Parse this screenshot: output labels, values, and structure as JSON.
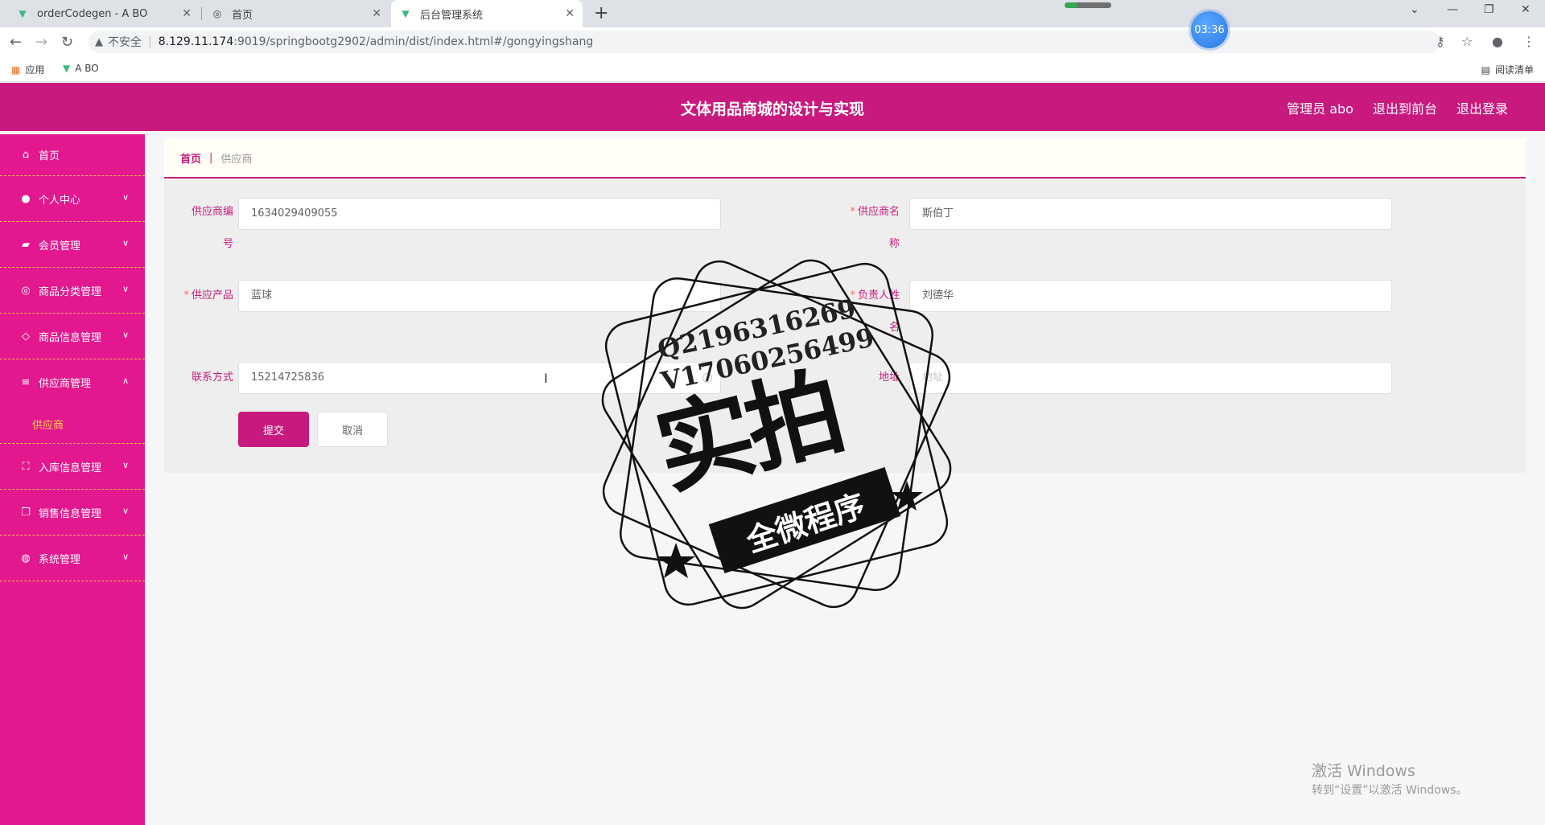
{
  "browser": {
    "tabs": [
      {
        "title": "orderCodegen - A BO"
      },
      {
        "title": "首页"
      },
      {
        "title": "后台管理系统"
      }
    ],
    "address": {
      "insecure_label": "不安全",
      "host": "8.129.11.174",
      "path": ":9019/springbootg2902/admin/dist/index.html#/gongyingshang"
    },
    "bookmarks": [
      {
        "label": "应用"
      },
      {
        "label": "A BO"
      }
    ],
    "reading_list": "阅读清单",
    "timer": "03:36"
  },
  "header": {
    "title": "文体用品商城的设计与实现",
    "user": "管理员 abo",
    "to_front": "退出到前台",
    "logout": "退出登录"
  },
  "sidebar": {
    "items": [
      {
        "label": "首页",
        "icon": "home-icon"
      },
      {
        "label": "个人中心",
        "icon": "user-icon"
      },
      {
        "label": "会员管理",
        "icon": "thumb-icon"
      },
      {
        "label": "商品分类管理",
        "icon": "compass-icon"
      },
      {
        "label": "商品信息管理",
        "icon": "goods-icon"
      },
      {
        "label": "供应商管理",
        "icon": "menu-icon"
      },
      {
        "label": "入库信息管理",
        "icon": "frame-icon"
      },
      {
        "label": "销售信息管理",
        "icon": "copy-icon"
      },
      {
        "label": "系统管理",
        "icon": "globe-icon"
      }
    ],
    "sub_active": "供应商"
  },
  "breadcrumb": {
    "home": "首页",
    "sep": "|",
    "current": "供应商"
  },
  "form": {
    "supplier_no_label_1": "供应商编",
    "supplier_no_label_2": "号",
    "supplier_no_value": "1634029409055",
    "supplier_name_label_1": "供应商名",
    "supplier_name_label_2": "称",
    "supplier_name_value": "斯伯丁",
    "product_label": "供应产品",
    "product_value": "蓝球",
    "contact_label_1": "负责人姓",
    "contact_label_2": "名",
    "contact_value": "刘德华",
    "phone_label": "联系方式",
    "phone_value": "15214725836",
    "address_label": "地址",
    "address_placeholder": "地址",
    "submit": "提交",
    "cancel": "取消"
  },
  "stamp": {
    "line1": "Q2196316269",
    "line2": "V17060256499",
    "big": "实拍",
    "banner": "全微程序"
  },
  "watermark": {
    "line1": "激活 Windows",
    "line2": "转到“设置”以激活 Windows。"
  }
}
